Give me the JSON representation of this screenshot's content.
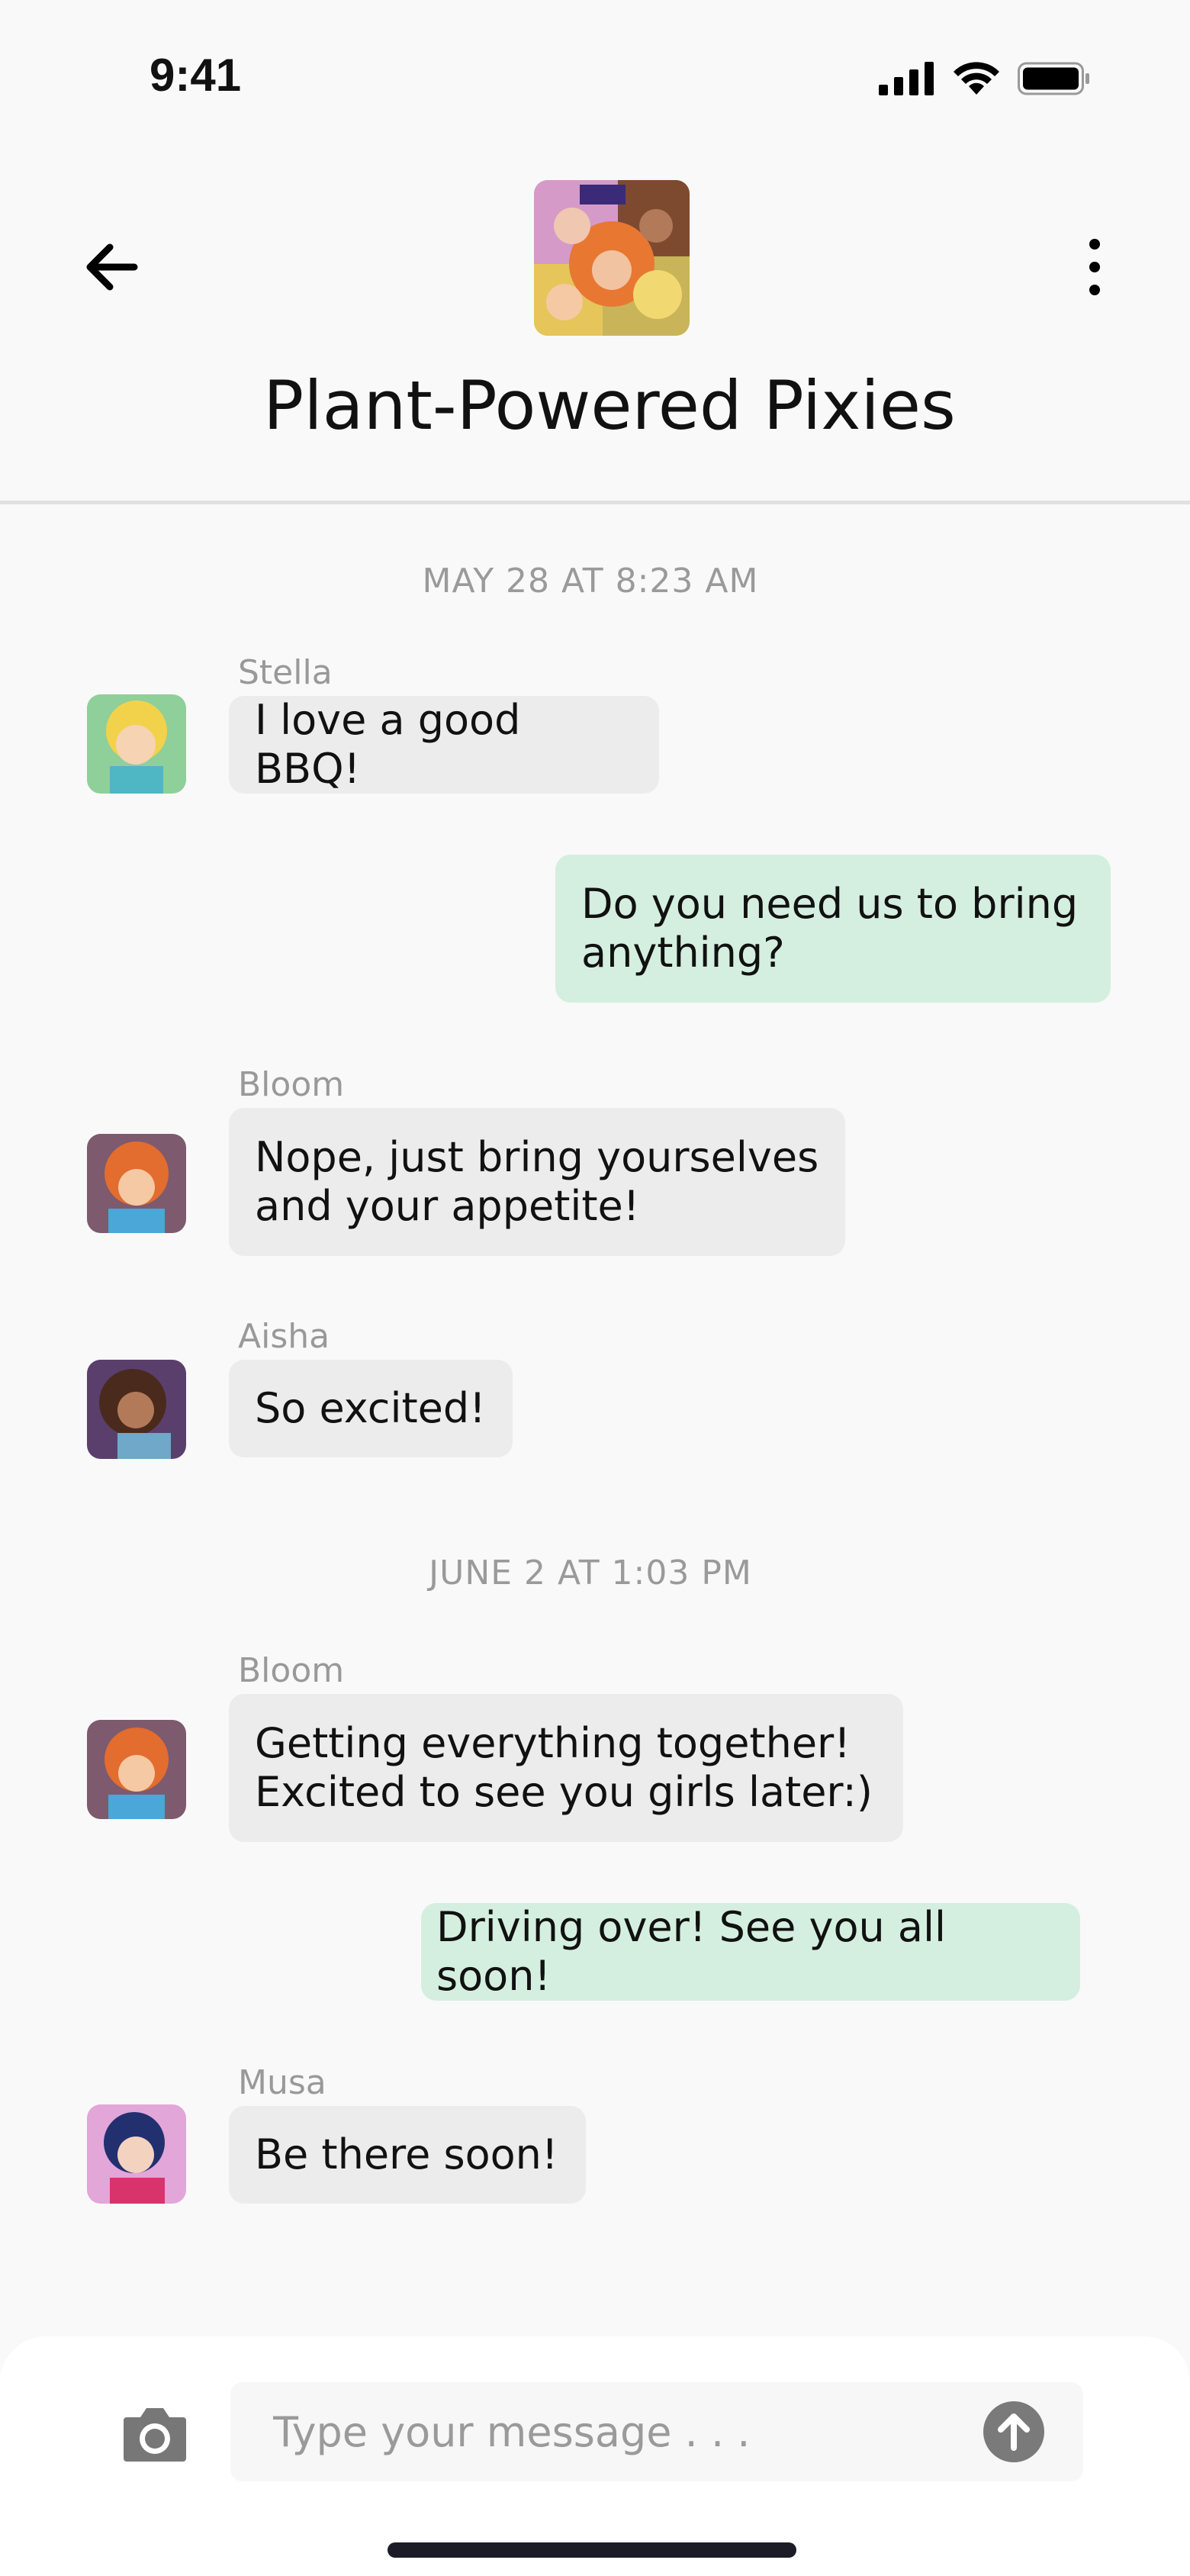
{
  "status": {
    "time": "9:41"
  },
  "header": {
    "title": "Plant-Powered Pixies"
  },
  "timeline": {
    "date1": "MAY 28 AT 8:23 AM",
    "date2": "JUNE 2 AT 1:03 PM"
  },
  "messages": [
    {
      "sender": "Stella",
      "text": "I love a good BBQ!"
    },
    {
      "sender": "",
      "text": "Do you need us to bring anything?"
    },
    {
      "sender": "Bloom",
      "text": "Nope, just bring yourselves and your appetite!"
    },
    {
      "sender": "Aisha",
      "text": "So excited!"
    },
    {
      "sender": "Bloom",
      "text": "Getting everything together! Excited to see you girls later:)"
    },
    {
      "sender": "",
      "text": "Driving over! See you all soon!"
    },
    {
      "sender": "Musa",
      "text": "Be there soon!"
    }
  ],
  "composer": {
    "placeholder": "Type your message . . ."
  },
  "icons": {
    "back": "arrow-left-icon",
    "more": "more-vertical-icon",
    "camera": "camera-icon",
    "send": "arrow-up-circle-icon",
    "signal": "cellular-signal-icon",
    "wifi": "wifi-icon",
    "battery": "battery-icon"
  },
  "colors": {
    "incoming_bubble": "#ececec",
    "outgoing_bubble": "#d4efdf",
    "meta_text": "#9a9a9a"
  }
}
